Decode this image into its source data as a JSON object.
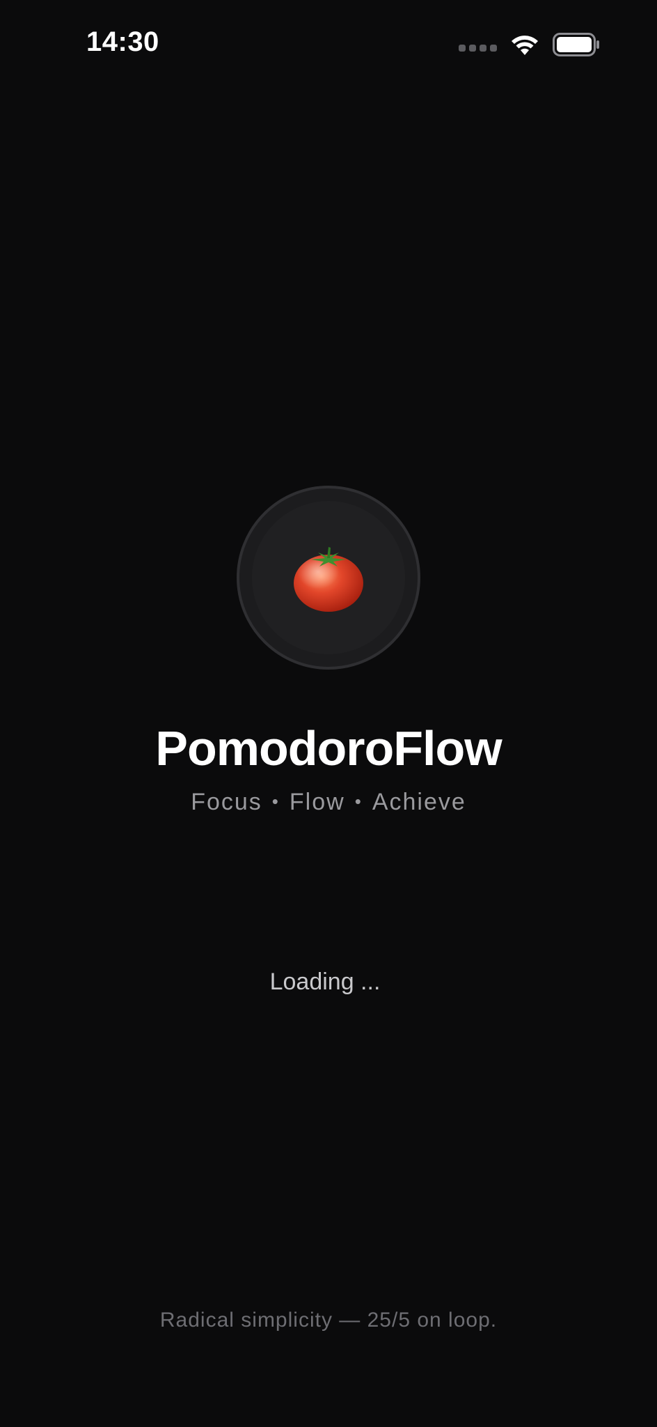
{
  "status_bar": {
    "time": "14:30",
    "icons": [
      "cellular-signal-icon",
      "wifi-icon",
      "battery-icon"
    ]
  },
  "splash": {
    "logo_icon": "tomato-icon",
    "app_title": "PomodoroFlow",
    "tagline": [
      "Focus",
      "Flow",
      "Achieve"
    ],
    "tagline_separator": "•",
    "loading_label": "Loading ...",
    "footer_text": "Radical simplicity — 25/5 on loop."
  },
  "colors": {
    "background": "#0b0b0c",
    "logo_ring": "#1c1c1e",
    "title": "#ffffff",
    "tagline": "#9a9a9e",
    "footer": "#6e6e73",
    "tomato": "#e2462a"
  }
}
